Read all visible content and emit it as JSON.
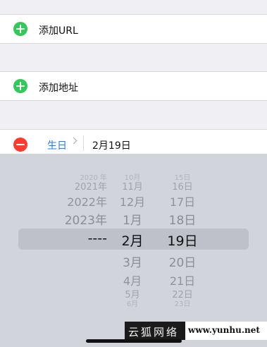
{
  "rows": {
    "add_url": "添加URL",
    "add_address": "添加地址",
    "birthday": {
      "label": "生日",
      "value": "2月19日"
    }
  },
  "picker": {
    "years": [
      "2020 年",
      "2021年",
      "2022年",
      "2023年",
      "----",
      "",
      "",
      "",
      ""
    ],
    "months": [
      "10月",
      "11月",
      "12月",
      "1月",
      "2月",
      "3月",
      "4月",
      "5月",
      "6月"
    ],
    "days": [
      "15日",
      "16日",
      "17日",
      "18日",
      "19日",
      "20日",
      "21日",
      "22日",
      "23日"
    ],
    "selected_index": 4
  },
  "watermark": {
    "brand": "云狐网络",
    "url": "www.yunhu.net"
  },
  "colors": {
    "add": "#34c759",
    "remove": "#ff3b30",
    "link": "#1f7cf0",
    "picker_bg": "#d2d4db"
  },
  "icons": [
    "plus-circle-icon",
    "minus-circle-icon",
    "chevron-right-icon"
  ]
}
